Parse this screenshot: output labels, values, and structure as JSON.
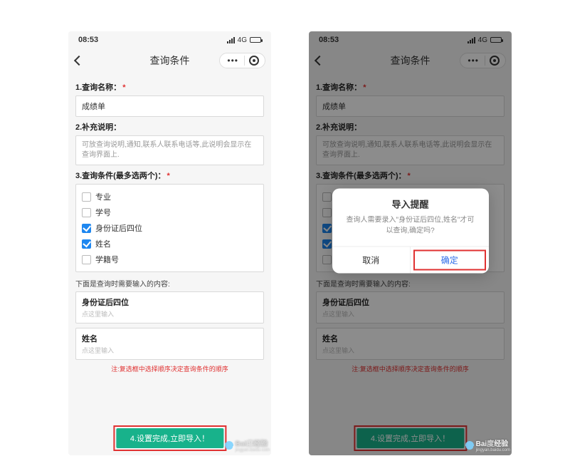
{
  "status": {
    "time": "08:53",
    "network": "4G"
  },
  "nav": {
    "title": "查询条件"
  },
  "section1": {
    "label": "1.查询名称：",
    "value": "成绩单"
  },
  "section2": {
    "label": "2.补充说明：",
    "placeholder": "可放查询说明,通知,联系人联系电话等,此说明会显示在查询界面上."
  },
  "section3": {
    "label": "3.查询条件(最多选两个)：",
    "options": [
      {
        "label": "专业",
        "checked": false
      },
      {
        "label": "学号",
        "checked": false
      },
      {
        "label": "身份证后四位",
        "checked": true
      },
      {
        "label": "姓名",
        "checked": true
      },
      {
        "label": "学籍号",
        "checked": false
      }
    ]
  },
  "inputsHeader": "下面是查询时需要输入的内容:",
  "inputs": [
    {
      "label": "身份证后四位",
      "placeholder": "点这里输入"
    },
    {
      "label": "姓名",
      "placeholder": "点这里输入"
    }
  ],
  "note": "注:复选框中选择顺序决定查询条件的顺序",
  "cta": "4.设置完成,立即导入！",
  "modal": {
    "title": "导入提醒",
    "body": "查询人需要录入\"身份证后四位,姓名\"才可以查询,确定吗?",
    "cancel": "取消",
    "confirm": "确定"
  },
  "watermark": {
    "brand": "Bai",
    "brand2": "经验",
    "sub": "jingyan.baidu.com"
  }
}
